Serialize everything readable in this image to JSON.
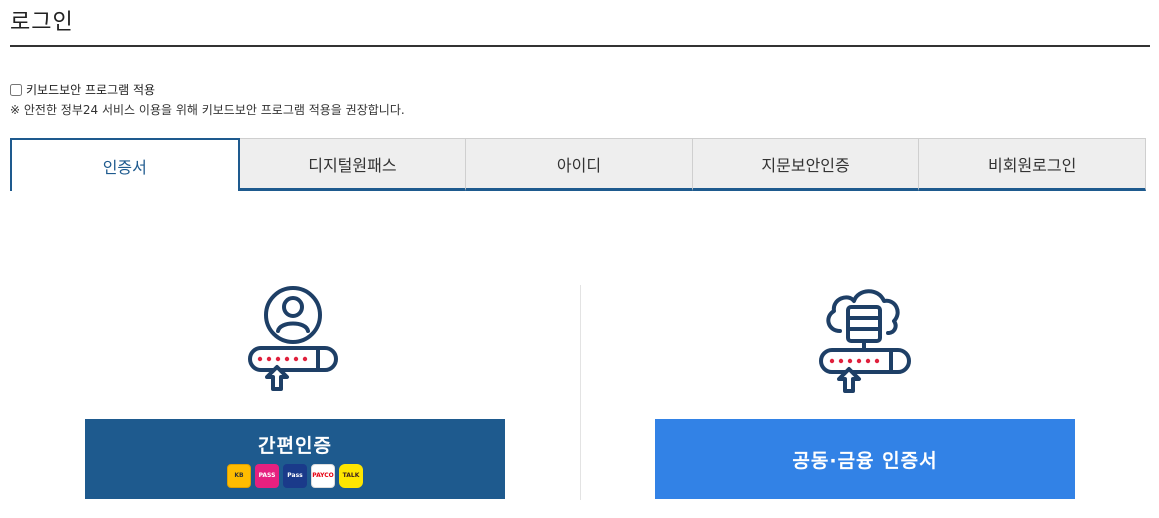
{
  "page": {
    "title": "로그인"
  },
  "keyboard_security": {
    "checkbox_label": "키보드보안 프로그램 적용",
    "note": "※ 안전한 정부24 서비스 이용을 위해 키보드보안 프로그램 적용을 권장합니다.",
    "checked": false
  },
  "tabs": [
    {
      "label": "인증서",
      "active": true
    },
    {
      "label": "디지털원패스",
      "active": false
    },
    {
      "label": "아이디",
      "active": false
    },
    {
      "label": "지문보안인증",
      "active": false
    },
    {
      "label": "비회원로그인",
      "active": false
    }
  ],
  "options": {
    "simple_auth": {
      "label": "간편인증",
      "providers": [
        {
          "name": "kb-icon",
          "text": "KB"
        },
        {
          "name": "pass-icon",
          "text": "PASS"
        },
        {
          "name": "samsung-pass-icon",
          "text": "Pass"
        },
        {
          "name": "payco-icon",
          "text": "PAYCO"
        },
        {
          "name": "kakao-talk-icon",
          "text": "TALK"
        }
      ]
    },
    "certificate": {
      "label": "공동·금융 인증서"
    }
  },
  "colors": {
    "primary": "#1e5a8e",
    "accent": "#3282e6",
    "pin_dot": "#e0203c"
  }
}
